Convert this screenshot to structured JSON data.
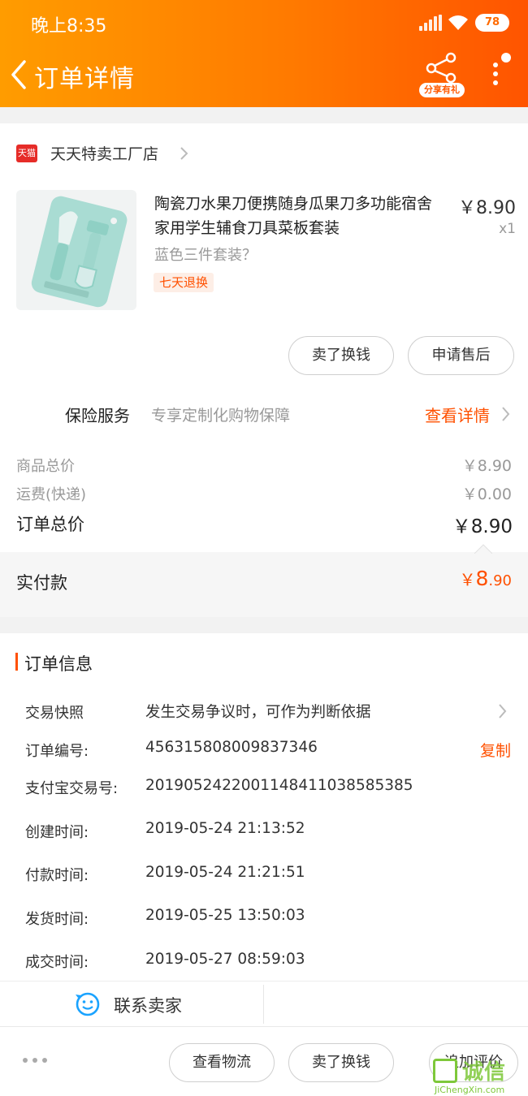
{
  "status_bar": {
    "time": "晚上8:35",
    "battery": "78"
  },
  "header": {
    "title": "订单详情",
    "share_label": "分享有礼"
  },
  "store": {
    "badge": "天猫",
    "name": "天天特卖工厂店"
  },
  "product": {
    "title": "陶瓷刀水果刀便携随身瓜果刀多功能宿舍家用学生辅食刀具菜板套装",
    "price": "￥8.90",
    "quantity": "x1",
    "sku": "蓝色三件套装？",
    "return_tag": "七天退换",
    "buttons": {
      "sell": "卖了换钱",
      "after_sale": "申请售后"
    }
  },
  "insurance": {
    "label": "保险服务",
    "desc": "专享定制化购物保障",
    "link": "查看详情"
  },
  "price_summary": {
    "goods_label": "商品总价",
    "goods_value": "￥8.90",
    "shipping_label": "运费(快递)",
    "shipping_value": "￥0.00",
    "total_label": "订单总价",
    "total_value": "￥8.90",
    "paid_label": "实付款",
    "paid_currency": "￥",
    "paid_int": "8",
    "paid_dec": ".90"
  },
  "order_info": {
    "title": "订单信息",
    "snapshot_label": "交易快照",
    "snapshot_value": "发生交易争议时，可作为判断依据",
    "order_no_label": "订单编号:",
    "order_no_value": "456315808009837346",
    "copy_label": "复制",
    "alipay_label": "支付宝交易号:",
    "alipay_value": "2019052422001148411038585385",
    "created_label": "创建时间:",
    "created_value": "2019-05-24 21:13:52",
    "paid_label": "付款时间:",
    "paid_value": "2019-05-24 21:21:51",
    "shipped_label": "发货时间:",
    "shipped_value": "2019-05-25 13:50:03",
    "closed_label": "成交时间:",
    "closed_value": "2019-05-27 08:59:03",
    "contact_label": "联系卖家"
  },
  "bottom_bar": {
    "logistics": "查看物流",
    "sell": "卖了换钱",
    "review": "追加评价"
  },
  "watermark": {
    "text": "诚信",
    "url": "JiChengXin.com"
  },
  "colors": {
    "accent": "#ff5000",
    "header_start": "#ff9c00",
    "header_end": "#ff5400",
    "tmall_red": "#e62c28"
  }
}
